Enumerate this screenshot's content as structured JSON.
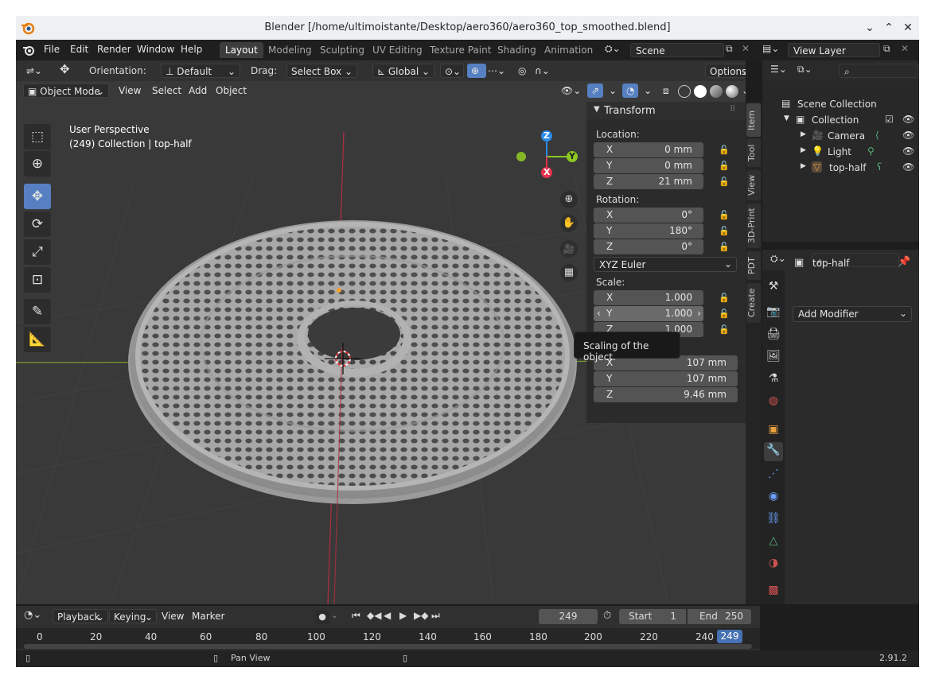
{
  "window": {
    "title": "Blender [/home/ultimoistante/Desktop/aero360/aero360_top_smoothed.blend]",
    "controls": [
      "minimize-icon",
      "maximize-icon",
      "close-icon"
    ]
  },
  "menu": [
    "File",
    "Edit",
    "Render",
    "Window",
    "Help"
  ],
  "workspaces": [
    "Layout",
    "Modeling",
    "Sculpting",
    "UV Editing",
    "Texture Paint",
    "Shading",
    "Animation"
  ],
  "scene": {
    "name": "Scene",
    "view_layer": "View Layer"
  },
  "tool_header": {
    "orientation_label": "Orientation:",
    "orientation_value": "Default",
    "drag_label": "Drag:",
    "drag_value": "Select Box",
    "transform_orientation": "Global",
    "options": "Options"
  },
  "viewport_header": {
    "mode": "Object Mode",
    "menus": [
      "View",
      "Select",
      "Add",
      "Object"
    ]
  },
  "overlay": {
    "perspective": "User Perspective",
    "collection_info": "(249) Collection | top-half",
    "gizmo_axes": [
      "Z",
      "Y",
      "X"
    ]
  },
  "npanel": {
    "tabs": [
      "Item",
      "Tool",
      "View",
      "3D-Print",
      "PDT",
      "Create"
    ],
    "panel_title": "Transform",
    "location_label": "Location:",
    "location": [
      {
        "axis": "X",
        "value": "0 mm"
      },
      {
        "axis": "Y",
        "value": "0 mm"
      },
      {
        "axis": "Z",
        "value": "21 mm"
      }
    ],
    "rotation_label": "Rotation:",
    "rotation": [
      {
        "axis": "X",
        "value": "0°"
      },
      {
        "axis": "Y",
        "value": "180°"
      },
      {
        "axis": "Z",
        "value": "0°"
      }
    ],
    "rotation_mode": "XYZ Euler",
    "scale_label": "Scale:",
    "scale": [
      {
        "axis": "X",
        "value": "1.000"
      },
      {
        "axis": "Y",
        "value": "1.000"
      },
      {
        "axis": "Z",
        "value": "1.000"
      }
    ],
    "dimensions": [
      {
        "axis": "X",
        "value": "107 mm"
      },
      {
        "axis": "Y",
        "value": "107 mm"
      },
      {
        "axis": "Z",
        "value": "9.46 mm"
      }
    ],
    "tooltip": "Scaling of the object."
  },
  "outliner": {
    "items": [
      {
        "label": "Scene Collection",
        "level": 0
      },
      {
        "label": "Collection",
        "level": 1
      },
      {
        "label": "Camera",
        "level": 2
      },
      {
        "label": "Light",
        "level": 2
      },
      {
        "label": "top-half",
        "level": 2
      }
    ]
  },
  "properties": {
    "object_name": "top-half",
    "add_modifier": "Add Modifier"
  },
  "timeline": {
    "menus": [
      "Playback",
      "Keying",
      "View",
      "Marker"
    ],
    "current_frame": "249",
    "start_label": "Start",
    "start_value": "1",
    "end_label": "End",
    "end_value": "250",
    "ruler": [
      "0",
      "20",
      "40",
      "60",
      "80",
      "100",
      "120",
      "140",
      "160",
      "180",
      "200",
      "220",
      "240"
    ],
    "playhead": "249"
  },
  "status": {
    "hint": "Pan View",
    "version": "2.91.2"
  },
  "colors": {
    "accent": "#5680c2",
    "x_axis": "#e6314c",
    "y_axis": "#8cc722",
    "z_axis": "#2c8ae8",
    "viewport_bg": "#393939"
  }
}
